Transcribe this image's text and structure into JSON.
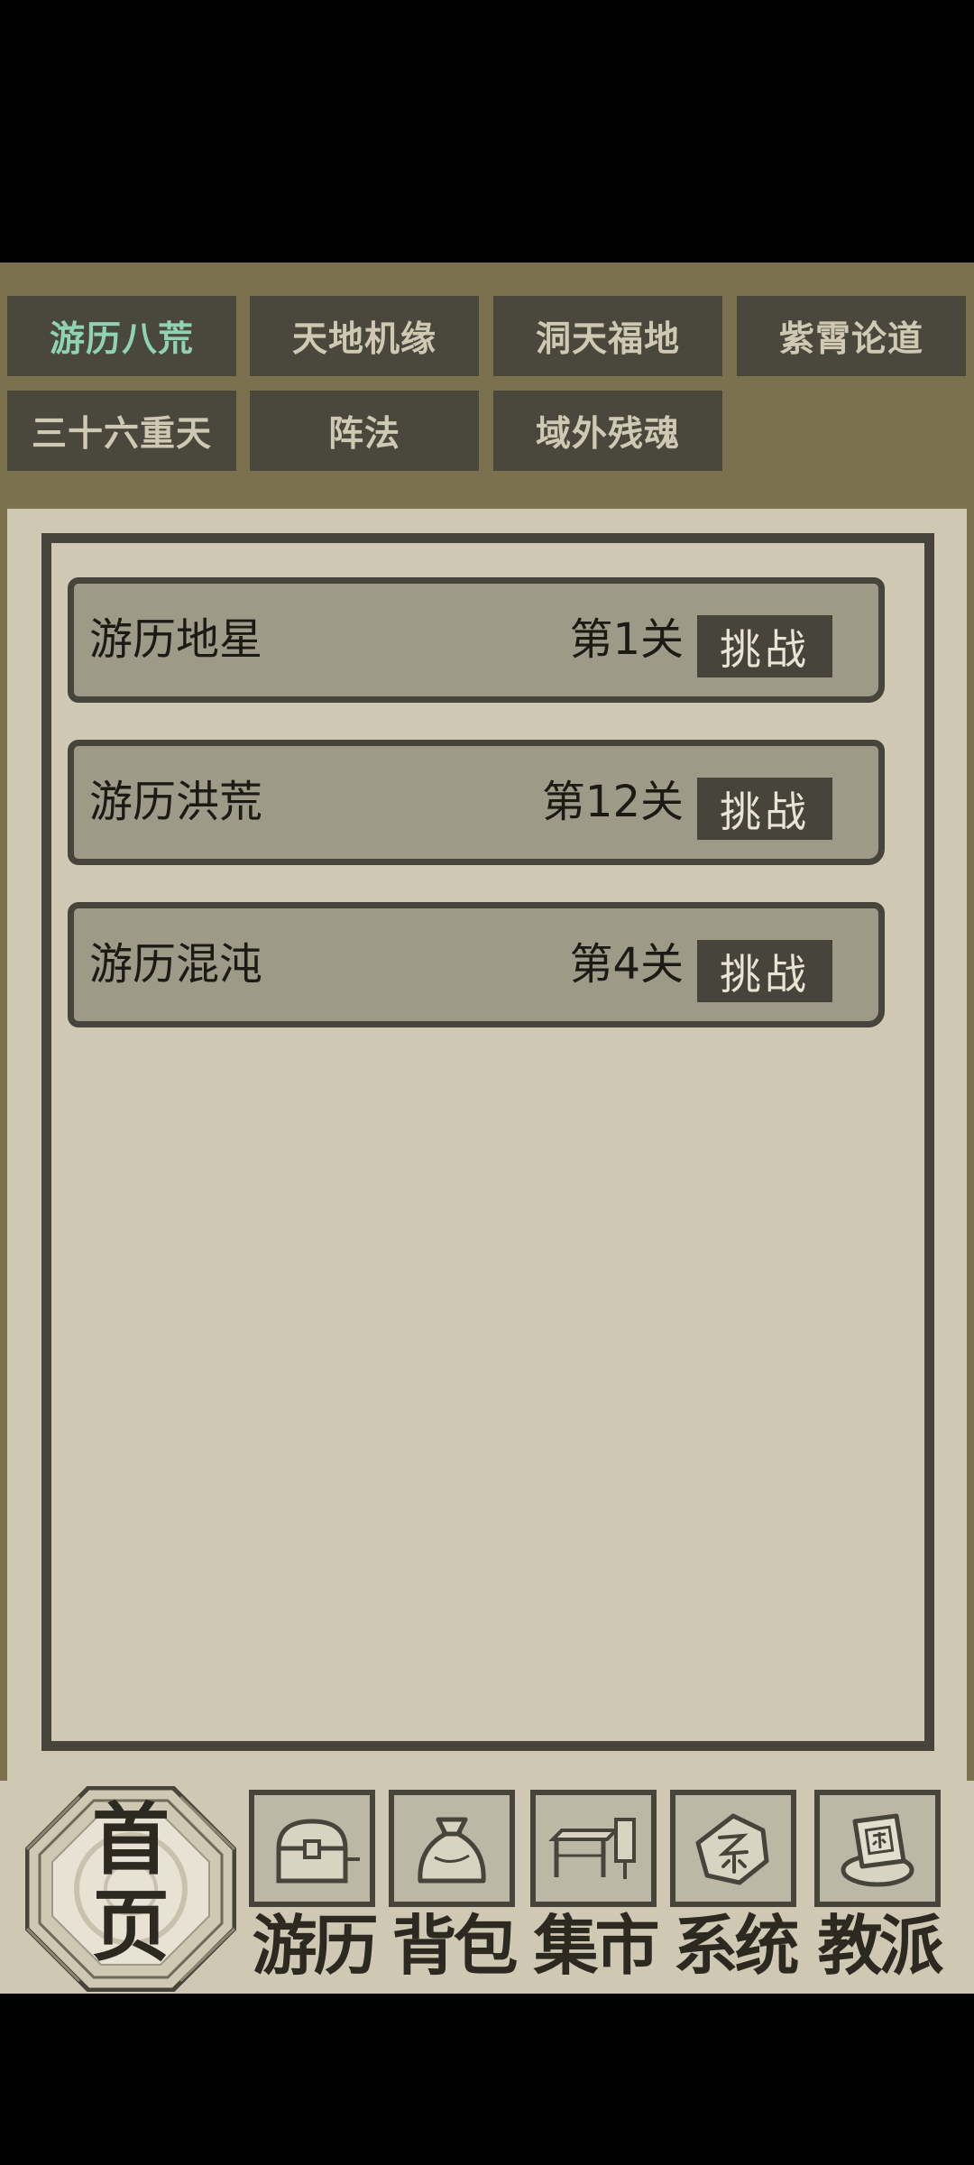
{
  "tabs": [
    {
      "label": "游历八荒",
      "active": true
    },
    {
      "label": "天地机缘",
      "active": false
    },
    {
      "label": "洞天福地",
      "active": false
    },
    {
      "label": "紫霄论道",
      "active": false
    },
    {
      "label": "三十六重天",
      "active": false
    },
    {
      "label": "阵法",
      "active": false
    },
    {
      "label": "域外残魂",
      "active": false
    }
  ],
  "stages": [
    {
      "name": "游历地星",
      "level": "第1关",
      "button": "挑战"
    },
    {
      "name": "游历洪荒",
      "level": "第12关",
      "button": "挑战"
    },
    {
      "name": "游历混沌",
      "level": "第4关",
      "button": "挑战"
    }
  ],
  "bottom_nav": {
    "home_label_top": "首",
    "home_label_bottom": "页",
    "items": [
      {
        "label": "游历",
        "icon": "treasure-chest-icon"
      },
      {
        "label": "背包",
        "icon": "bag-icon"
      },
      {
        "label": "集市",
        "icon": "market-stall-icon"
      },
      {
        "label": "系统",
        "icon": "system-seal-icon"
      },
      {
        "label": "教派",
        "icon": "sect-banner-icon"
      }
    ]
  },
  "colors": {
    "background": "#7c714e",
    "panel": "#cfc8b3",
    "dark": "#47443b",
    "row": "#9d9a87",
    "active_tab_text": "#8fd3b4"
  }
}
